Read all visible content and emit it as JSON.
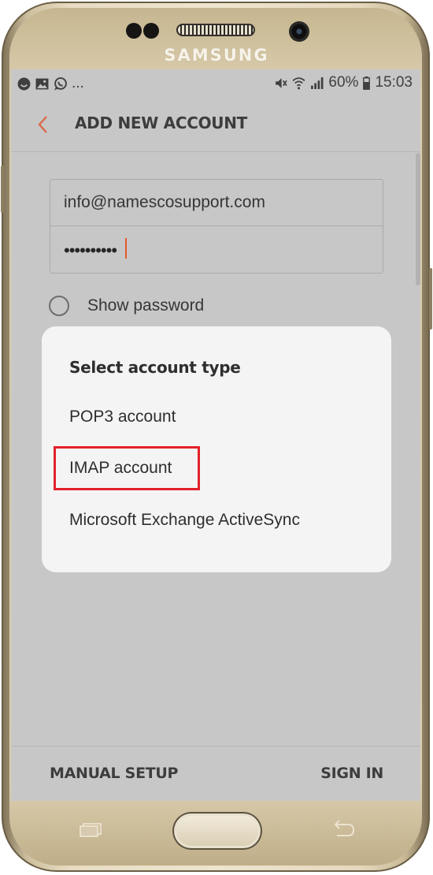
{
  "device": {
    "brand": "SAMSUNG"
  },
  "status_bar": {
    "left_icons": [
      "emoji-icon",
      "image-icon",
      "whatsapp-icon"
    ],
    "more": "...",
    "right_icons": [
      "mute-vibrate-icon",
      "wifi-icon",
      "signal-icon"
    ],
    "battery": "60%",
    "battery_icon": "battery-icon",
    "time": "15:03"
  },
  "app_bar": {
    "title": "ADD NEW ACCOUNT",
    "back_icon": "chevron-left-icon"
  },
  "form": {
    "email": "info@namescosupport.com",
    "password_mask": "••••••••••",
    "show_password_label": "Show password"
  },
  "dialog": {
    "title": "Select account type",
    "options": [
      "POP3 account",
      "IMAP account",
      "Microsoft Exchange ActiveSync"
    ],
    "highlighted_option": "IMAP account"
  },
  "bottom_bar": {
    "manual_setup": "MANUAL SETUP",
    "sign_in": "SIGN IN"
  },
  "colors": {
    "accent": "#e5582a",
    "highlight_border": "#e22129",
    "screen_dim": "#c7c7c7",
    "dialog_bg": "#f4f4f4",
    "phone_gold": "#ddd0b2"
  }
}
